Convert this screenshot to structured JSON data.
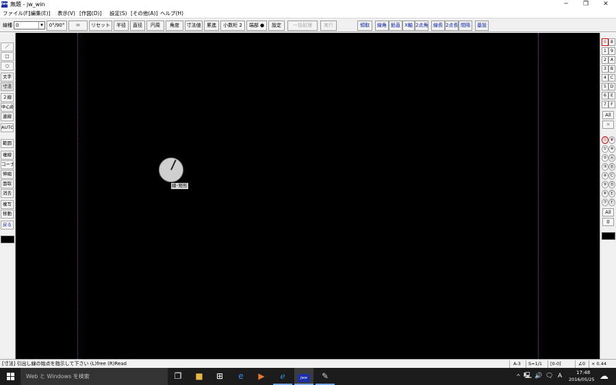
{
  "window": {
    "app_icon_text": "Jww",
    "title": "無題 - jw_win",
    "controls": {
      "minimize": "─",
      "maximize": "❐",
      "close": "✕"
    }
  },
  "menu": [
    "ファイル(F)",
    "[編集(E)]",
    "表示(V)",
    "[作図(D)]",
    "設定(S)",
    "[その他(A)]",
    "ヘルプ(H)"
  ],
  "toolbar": {
    "line_type_label": "線種",
    "line_type_value": "0",
    "buttons": [
      "0°/90°",
      "＝",
      "リセット",
      "半径",
      "直径",
      "円周",
      "角度",
      "寸法値",
      "累進",
      "小数桁 2",
      "端部 ●",
      "設定",
      "一括処理",
      "実行"
    ],
    "right_buttons": [
      "傾取",
      "線角",
      "鉛直",
      "X軸",
      "2点角",
      "線長",
      "2点長",
      "間隔",
      "基設"
    ]
  },
  "left_tools": [
    "／",
    "□",
    "○",
    "文字",
    "寸法",
    "２線",
    "中心線",
    "連線",
    "AUTO",
    "範囲",
    "複線",
    "コーナー",
    "伸縮",
    "面取",
    "消去",
    "複写",
    "移動",
    "戻る"
  ],
  "right_panel": {
    "layer_groups": [
      [
        "0",
        "8"
      ],
      [
        "1",
        "9"
      ],
      [
        "2",
        "A"
      ],
      [
        "3",
        "B"
      ],
      [
        "4",
        "C"
      ],
      [
        "5",
        "D"
      ],
      [
        "6",
        "E"
      ],
      [
        "7",
        "F"
      ]
    ],
    "all_label": "All",
    "x_label": "✕",
    "layers": [
      [
        "⓪",
        "⑧"
      ],
      [
        "①",
        "⑨"
      ],
      [
        "②",
        "Ⓐ"
      ],
      [
        "③",
        "Ⓑ"
      ],
      [
        "④",
        "Ⓒ"
      ],
      [
        "⑤",
        "Ⓓ"
      ],
      [
        "⑥",
        "Ⓔ"
      ],
      [
        "⑦",
        "Ⓕ"
      ]
    ],
    "all2_label": "All",
    "zero_label": "0"
  },
  "canvas": {
    "background": "#000000",
    "guide_color": "#8a3ba0",
    "cursor_tip": "線･矩形"
  },
  "statusbar": {
    "message": "[寸法] 引出し線の始点を指示して下さい (L)free (R)Read",
    "paper": "A-3",
    "scale": "S=1/1",
    "layer": "[0-0]",
    "angle": "∠0",
    "zoom": "× 0.44"
  },
  "taskbar": {
    "search_placeholder": "Web と Windows を検索",
    "clock_time": "17:48",
    "clock_date": "2016/05/25",
    "ime": "A",
    "tray_icons": [
      "^",
      "🖳",
      "🔊",
      "🗨"
    ]
  },
  "colors": {
    "accent_blue": "#001aa8",
    "active_red": "#d00000"
  }
}
